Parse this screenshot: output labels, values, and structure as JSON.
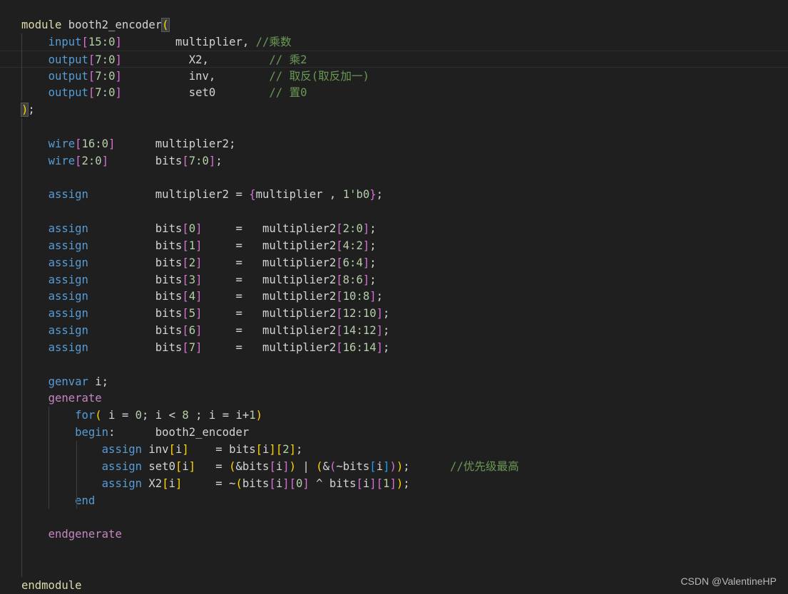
{
  "colors": {
    "background": "#1f1f1f",
    "keyword": "#569cd6",
    "keyword_control": "#c586c0",
    "module_keyword": "#dcdcaa",
    "number": "#b5cea8",
    "comment": "#6a9955",
    "bracket_level1": "#ffd700",
    "bracket_level2": "#da70d6",
    "bracket_level3": "#179fff",
    "text": "#d4d4d4"
  },
  "code_lines": [
    [
      [
        "kw3",
        "module"
      ],
      [
        "plain",
        " booth2_encoder"
      ],
      [
        "perr",
        "("
      ]
    ],
    [
      [
        "plain",
        "    "
      ],
      [
        "kw",
        "input"
      ],
      [
        "b2",
        "["
      ],
      [
        "num",
        "15:0"
      ],
      [
        "b2",
        "]"
      ],
      [
        "plain",
        "        multiplier, "
      ],
      [
        "com",
        "//乘数"
      ]
    ],
    [
      [
        "plain",
        "    "
      ],
      [
        "kw",
        "output"
      ],
      [
        "b2",
        "["
      ],
      [
        "num",
        "7:0"
      ],
      [
        "b2",
        "]"
      ],
      [
        "plain",
        "          X2,         "
      ],
      [
        "com",
        "// 乘2"
      ]
    ],
    [
      [
        "plain",
        "    "
      ],
      [
        "kw",
        "output"
      ],
      [
        "b2",
        "["
      ],
      [
        "num",
        "7:0"
      ],
      [
        "b2",
        "]"
      ],
      [
        "plain",
        "          inv,        "
      ],
      [
        "com",
        "// 取反(取反加一)"
      ]
    ],
    [
      [
        "plain",
        "    "
      ],
      [
        "kw",
        "output"
      ],
      [
        "b2",
        "["
      ],
      [
        "num",
        "7:0"
      ],
      [
        "b2",
        "]"
      ],
      [
        "plain",
        "          set0        "
      ],
      [
        "com",
        "// 置0"
      ]
    ],
    [
      [
        "perr",
        ")"
      ],
      [
        "plain",
        ";"
      ]
    ],
    [],
    [
      [
        "plain",
        "    "
      ],
      [
        "kw",
        "wire"
      ],
      [
        "b2",
        "["
      ],
      [
        "num",
        "16:0"
      ],
      [
        "b2",
        "]"
      ],
      [
        "plain",
        "      multiplier2;"
      ]
    ],
    [
      [
        "plain",
        "    "
      ],
      [
        "kw",
        "wire"
      ],
      [
        "b2",
        "["
      ],
      [
        "num",
        "2:0"
      ],
      [
        "b2",
        "]"
      ],
      [
        "plain",
        "       bits"
      ],
      [
        "b2",
        "["
      ],
      [
        "num",
        "7:0"
      ],
      [
        "b2",
        "]"
      ],
      [
        "plain",
        ";"
      ]
    ],
    [],
    [
      [
        "plain",
        "    "
      ],
      [
        "kw",
        "assign"
      ],
      [
        "plain",
        "          multiplier2 = "
      ],
      [
        "b2",
        "{"
      ],
      [
        "plain",
        "multiplier , "
      ],
      [
        "num",
        "1'b0"
      ],
      [
        "b2",
        "}"
      ],
      [
        "plain",
        ";"
      ]
    ],
    [],
    [
      [
        "plain",
        "    "
      ],
      [
        "kw",
        "assign"
      ],
      [
        "plain",
        "          bits"
      ],
      [
        "b2",
        "["
      ],
      [
        "num",
        "0"
      ],
      [
        "b2",
        "]"
      ],
      [
        "plain",
        "     =   multiplier2"
      ],
      [
        "b2",
        "["
      ],
      [
        "num",
        "2:0"
      ],
      [
        "b2",
        "]"
      ],
      [
        "plain",
        ";"
      ]
    ],
    [
      [
        "plain",
        "    "
      ],
      [
        "kw",
        "assign"
      ],
      [
        "plain",
        "          bits"
      ],
      [
        "b2",
        "["
      ],
      [
        "num",
        "1"
      ],
      [
        "b2",
        "]"
      ],
      [
        "plain",
        "     =   multiplier2"
      ],
      [
        "b2",
        "["
      ],
      [
        "num",
        "4:2"
      ],
      [
        "b2",
        "]"
      ],
      [
        "plain",
        ";"
      ]
    ],
    [
      [
        "plain",
        "    "
      ],
      [
        "kw",
        "assign"
      ],
      [
        "plain",
        "          bits"
      ],
      [
        "b2",
        "["
      ],
      [
        "num",
        "2"
      ],
      [
        "b2",
        "]"
      ],
      [
        "plain",
        "     =   multiplier2"
      ],
      [
        "b2",
        "["
      ],
      [
        "num",
        "6:4"
      ],
      [
        "b2",
        "]"
      ],
      [
        "plain",
        ";"
      ]
    ],
    [
      [
        "plain",
        "    "
      ],
      [
        "kw",
        "assign"
      ],
      [
        "plain",
        "          bits"
      ],
      [
        "b2",
        "["
      ],
      [
        "num",
        "3"
      ],
      [
        "b2",
        "]"
      ],
      [
        "plain",
        "     =   multiplier2"
      ],
      [
        "b2",
        "["
      ],
      [
        "num",
        "8:6"
      ],
      [
        "b2",
        "]"
      ],
      [
        "plain",
        ";"
      ]
    ],
    [
      [
        "plain",
        "    "
      ],
      [
        "kw",
        "assign"
      ],
      [
        "plain",
        "          bits"
      ],
      [
        "b2",
        "["
      ],
      [
        "num",
        "4"
      ],
      [
        "b2",
        "]"
      ],
      [
        "plain",
        "     =   multiplier2"
      ],
      [
        "b2",
        "["
      ],
      [
        "num",
        "10:8"
      ],
      [
        "b2",
        "]"
      ],
      [
        "plain",
        ";"
      ]
    ],
    [
      [
        "plain",
        "    "
      ],
      [
        "kw",
        "assign"
      ],
      [
        "plain",
        "          bits"
      ],
      [
        "b2",
        "["
      ],
      [
        "num",
        "5"
      ],
      [
        "b2",
        "]"
      ],
      [
        "plain",
        "     =   multiplier2"
      ],
      [
        "b2",
        "["
      ],
      [
        "num",
        "12:10"
      ],
      [
        "b2",
        "]"
      ],
      [
        "plain",
        ";"
      ]
    ],
    [
      [
        "plain",
        "    "
      ],
      [
        "kw",
        "assign"
      ],
      [
        "plain",
        "          bits"
      ],
      [
        "b2",
        "["
      ],
      [
        "num",
        "6"
      ],
      [
        "b2",
        "]"
      ],
      [
        "plain",
        "     =   multiplier2"
      ],
      [
        "b2",
        "["
      ],
      [
        "num",
        "14:12"
      ],
      [
        "b2",
        "]"
      ],
      [
        "plain",
        ";"
      ]
    ],
    [
      [
        "plain",
        "    "
      ],
      [
        "kw",
        "assign"
      ],
      [
        "plain",
        "          bits"
      ],
      [
        "b2",
        "["
      ],
      [
        "num",
        "7"
      ],
      [
        "b2",
        "]"
      ],
      [
        "plain",
        "     =   multiplier2"
      ],
      [
        "b2",
        "["
      ],
      [
        "num",
        "16:14"
      ],
      [
        "b2",
        "]"
      ],
      [
        "plain",
        ";"
      ]
    ],
    [],
    [
      [
        "plain",
        "    "
      ],
      [
        "kw",
        "genvar"
      ],
      [
        "plain",
        " i;"
      ]
    ],
    [
      [
        "plain",
        "    "
      ],
      [
        "kw2",
        "generate"
      ]
    ],
    [
      [
        "plain",
        "        "
      ],
      [
        "kw",
        "for"
      ],
      [
        "b1",
        "("
      ],
      [
        "plain",
        " i = "
      ],
      [
        "num",
        "0"
      ],
      [
        "plain",
        "; i < "
      ],
      [
        "num",
        "8"
      ],
      [
        "plain",
        " ; i = i+"
      ],
      [
        "num",
        "1"
      ],
      [
        "b1",
        ")"
      ]
    ],
    [
      [
        "plain",
        "        "
      ],
      [
        "kw",
        "begin"
      ],
      [
        "plain",
        ":      booth2_encoder"
      ]
    ],
    [
      [
        "plain",
        "            "
      ],
      [
        "kw",
        "assign"
      ],
      [
        "plain",
        " inv"
      ],
      [
        "b1",
        "["
      ],
      [
        "plain",
        "i"
      ],
      [
        "b1",
        "]"
      ],
      [
        "plain",
        "    = bits"
      ],
      [
        "b1",
        "["
      ],
      [
        "plain",
        "i"
      ],
      [
        "b1",
        "]"
      ],
      [
        "b1",
        "["
      ],
      [
        "num",
        "2"
      ],
      [
        "b1",
        "]"
      ],
      [
        "plain",
        ";"
      ]
    ],
    [
      [
        "plain",
        "            "
      ],
      [
        "kw",
        "assign"
      ],
      [
        "plain",
        " set0"
      ],
      [
        "b1",
        "["
      ],
      [
        "plain",
        "i"
      ],
      [
        "b1",
        "]"
      ],
      [
        "plain",
        "   = "
      ],
      [
        "b1",
        "("
      ],
      [
        "plain",
        "&bits"
      ],
      [
        "b2",
        "["
      ],
      [
        "plain",
        "i"
      ],
      [
        "b2",
        "]"
      ],
      [
        "b1",
        ")"
      ],
      [
        "plain",
        " | "
      ],
      [
        "b1",
        "("
      ],
      [
        "plain",
        "&"
      ],
      [
        "b2",
        "("
      ],
      [
        "plain",
        "~bits"
      ],
      [
        "b3",
        "["
      ],
      [
        "plain",
        "i"
      ],
      [
        "b3",
        "]"
      ],
      [
        "b2",
        ")"
      ],
      [
        "b1",
        ")"
      ],
      [
        "plain",
        ";      "
      ],
      [
        "com",
        "//优先级最高"
      ]
    ],
    [
      [
        "plain",
        "            "
      ],
      [
        "kw",
        "assign"
      ],
      [
        "plain",
        " X2"
      ],
      [
        "b1",
        "["
      ],
      [
        "plain",
        "i"
      ],
      [
        "b1",
        "]"
      ],
      [
        "plain",
        "     = ~"
      ],
      [
        "b1",
        "("
      ],
      [
        "plain",
        "bits"
      ],
      [
        "b2",
        "["
      ],
      [
        "plain",
        "i"
      ],
      [
        "b2",
        "]"
      ],
      [
        "b2",
        "["
      ],
      [
        "num",
        "0"
      ],
      [
        "b2",
        "]"
      ],
      [
        "plain",
        " ^ bits"
      ],
      [
        "b2",
        "["
      ],
      [
        "plain",
        "i"
      ],
      [
        "b2",
        "]"
      ],
      [
        "b2",
        "["
      ],
      [
        "num",
        "1"
      ],
      [
        "b2",
        "]"
      ],
      [
        "b1",
        ")"
      ],
      [
        "plain",
        ";"
      ]
    ],
    [
      [
        "plain",
        "        "
      ],
      [
        "kw",
        "end"
      ]
    ],
    [],
    [
      [
        "plain",
        "    "
      ],
      [
        "kw2",
        "endgenerate"
      ]
    ],
    [],
    [],
    [
      [
        "kw3",
        "endmodule"
      ]
    ]
  ],
  "watermark": "CSDN @ValentineHP"
}
